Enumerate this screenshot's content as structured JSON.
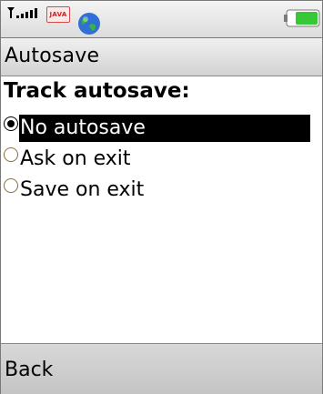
{
  "status_bar": {
    "java_badge": "JAVA",
    "icons": [
      "signal-strength-icon",
      "java-icon",
      "globe-icon",
      "battery-icon"
    ],
    "battery_color": "#37c837"
  },
  "title_bar": {
    "title": "Autosave"
  },
  "content": {
    "heading": "Track autosave:",
    "options": [
      {
        "label": "No autosave",
        "selected": true
      },
      {
        "label": "Ask on exit",
        "selected": false
      },
      {
        "label": "Save on exit",
        "selected": false
      }
    ]
  },
  "softkeys": {
    "left": "Back"
  },
  "colors": {
    "selection_bg": "#000000",
    "selection_fg": "#ffffff"
  }
}
